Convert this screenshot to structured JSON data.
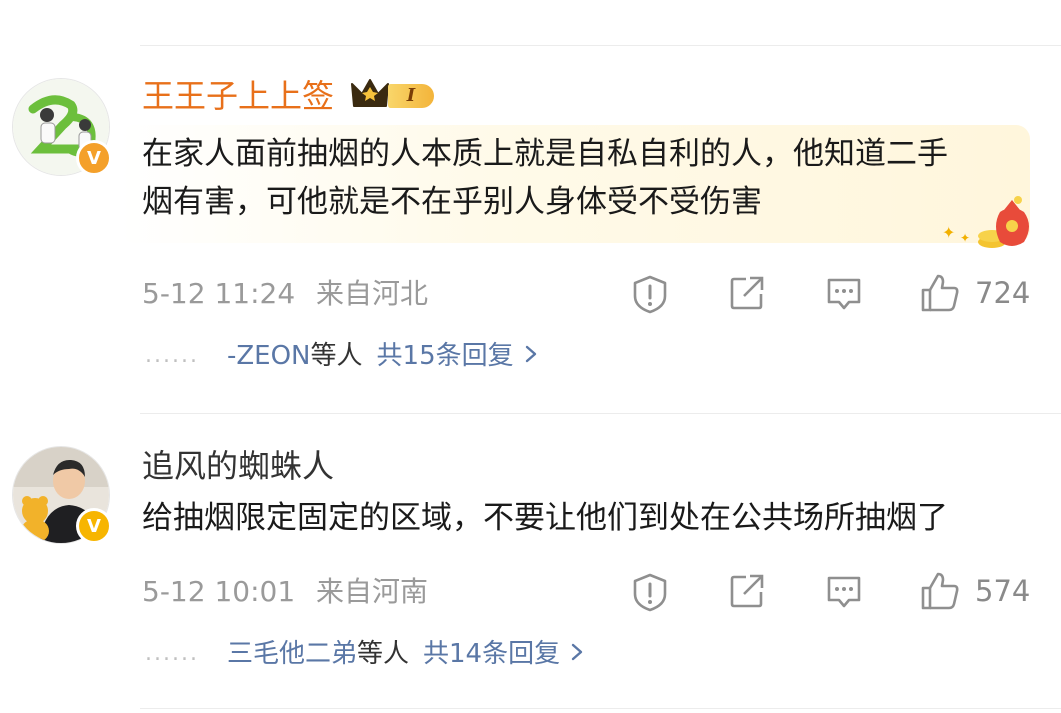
{
  "comments": [
    {
      "username": "王王子上上签",
      "vip_level": "I",
      "text_line1": "在家人面前抽烟的人本质上就是自私自利的人，他知道二手",
      "text_line2": "烟有害，可他就是不在乎别人身体受不受伤害",
      "date": "5-12 11:24",
      "location": "来自河北",
      "likes": "724",
      "reply_names": "-ZEON",
      "reply_suffix": "等人",
      "reply_total": "共15条回复",
      "badge_label": "V",
      "username_color": "#e8701a",
      "badge_color": "#f4a02a"
    },
    {
      "username": "追风的蜘蛛人",
      "text": "给抽烟限定固定的区域，不要让他们到处在公共场所抽烟了",
      "date": "5-12 10:01",
      "location": "来自河南",
      "likes": "574",
      "reply_names": "三毛他二弟",
      "reply_suffix": "等人",
      "reply_total": "共14条回复",
      "badge_label": "V",
      "username_color": "#333333",
      "badge_color": "#f7b500"
    }
  ],
  "reply_dots": "......",
  "chevron": "›",
  "icons": [
    "warning-icon",
    "share-icon",
    "comment-icon",
    "thumbs-up-icon",
    "crown-icon",
    "chevron-right-icon"
  ]
}
